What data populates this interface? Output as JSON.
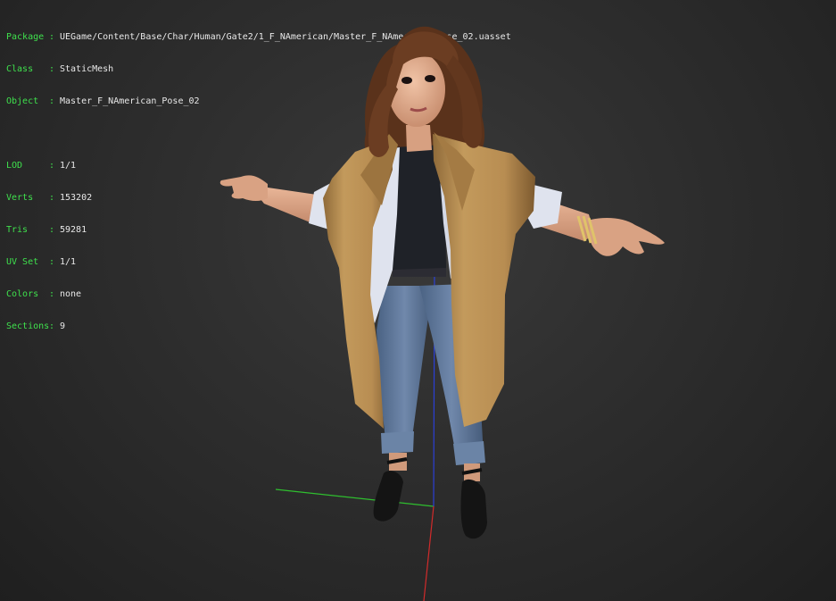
{
  "info_overlay": {
    "separator": ":",
    "asset": [
      {
        "label": "Package",
        "value": "UEGame/Content/Base/Char/Human/Gate2/1_F_NAmerican/Master_F_NAmerican_Pose_02.uasset"
      },
      {
        "label": "Class",
        "value": "StaticMesh"
      },
      {
        "label": "Object",
        "value": "Master_F_NAmerican_Pose_02"
      }
    ],
    "stats": [
      {
        "label": "LOD",
        "value": "1/1"
      },
      {
        "label": "Verts",
        "value": "153202"
      },
      {
        "label": "Tris",
        "value": "59281"
      },
      {
        "label": "UV Set",
        "value": "1/1"
      },
      {
        "label": "Colors",
        "value": "none"
      },
      {
        "label": "Sections",
        "value": "9"
      }
    ]
  },
  "axes": {
    "x_axis_color": "#d22b2b",
    "y_axis_color": "#2fbf2f",
    "z_axis_color": "#2b3fd6"
  },
  "colors": {
    "label_green": "#3fe14d",
    "coat": "#b58a4e",
    "shirt": "#dfe3ee",
    "jeans": "#5d7597",
    "hair": "#6b3d22",
    "skin": "#e1ab8c"
  }
}
